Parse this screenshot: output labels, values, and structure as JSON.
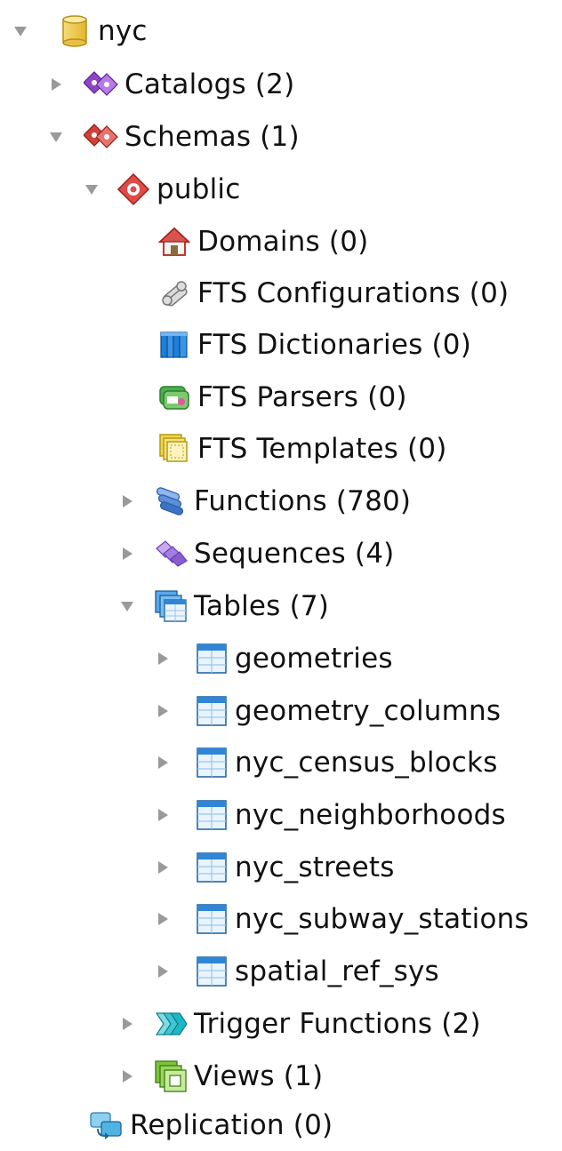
{
  "tree": {
    "root": {
      "label": "nyc",
      "icon": "database-icon",
      "expanded": true
    },
    "catalogs": {
      "label": "Catalogs (2)",
      "icon": "catalogs-icon",
      "expanded": false
    },
    "schemas": {
      "label": "Schemas (1)",
      "icon": "schemas-icon",
      "expanded": true
    },
    "public": {
      "label": "public",
      "icon": "schema-icon",
      "expanded": true
    },
    "domains": {
      "label": "Domains (0)",
      "icon": "domains-icon"
    },
    "fts_configurations": {
      "label": "FTS Configurations (0)",
      "icon": "fts-configurations-icon"
    },
    "fts_dictionaries": {
      "label": "FTS Dictionaries (0)",
      "icon": "fts-dictionaries-icon"
    },
    "fts_parsers": {
      "label": "FTS Parsers (0)",
      "icon": "fts-parsers-icon"
    },
    "fts_templates": {
      "label": "FTS Templates (0)",
      "icon": "fts-templates-icon"
    },
    "functions": {
      "label": "Functions (780)",
      "icon": "functions-icon",
      "expanded": false
    },
    "sequences": {
      "label": "Sequences (4)",
      "icon": "sequences-icon",
      "expanded": false
    },
    "tables": {
      "label": "Tables (7)",
      "icon": "tables-icon",
      "expanded": true,
      "items": [
        {
          "label": "geometries",
          "icon": "table-icon"
        },
        {
          "label": "geometry_columns",
          "icon": "table-icon"
        },
        {
          "label": "nyc_census_blocks",
          "icon": "table-icon"
        },
        {
          "label": "nyc_neighborhoods",
          "icon": "table-icon"
        },
        {
          "label": "nyc_streets",
          "icon": "table-icon"
        },
        {
          "label": "nyc_subway_stations",
          "icon": "table-icon"
        },
        {
          "label": "spatial_ref_sys",
          "icon": "table-icon"
        }
      ]
    },
    "trigger_functions": {
      "label": "Trigger Functions (2)",
      "icon": "trigger-functions-icon",
      "expanded": false
    },
    "views": {
      "label": "Views (1)",
      "icon": "views-icon",
      "expanded": false
    },
    "replication": {
      "label": "Replication (0)",
      "icon": "replication-icon"
    }
  },
  "colors": {
    "twisty": "#9a9a9a",
    "text": "#111111",
    "database": "#f2cf55",
    "catalogs": "#8e44c9",
    "schemas": "#d2403a",
    "functions": "#5b8fd9",
    "sequences": "#a67de0",
    "tables": "#2f86d6",
    "trigger": "#1fb6c6",
    "views": "#7cc43a"
  }
}
